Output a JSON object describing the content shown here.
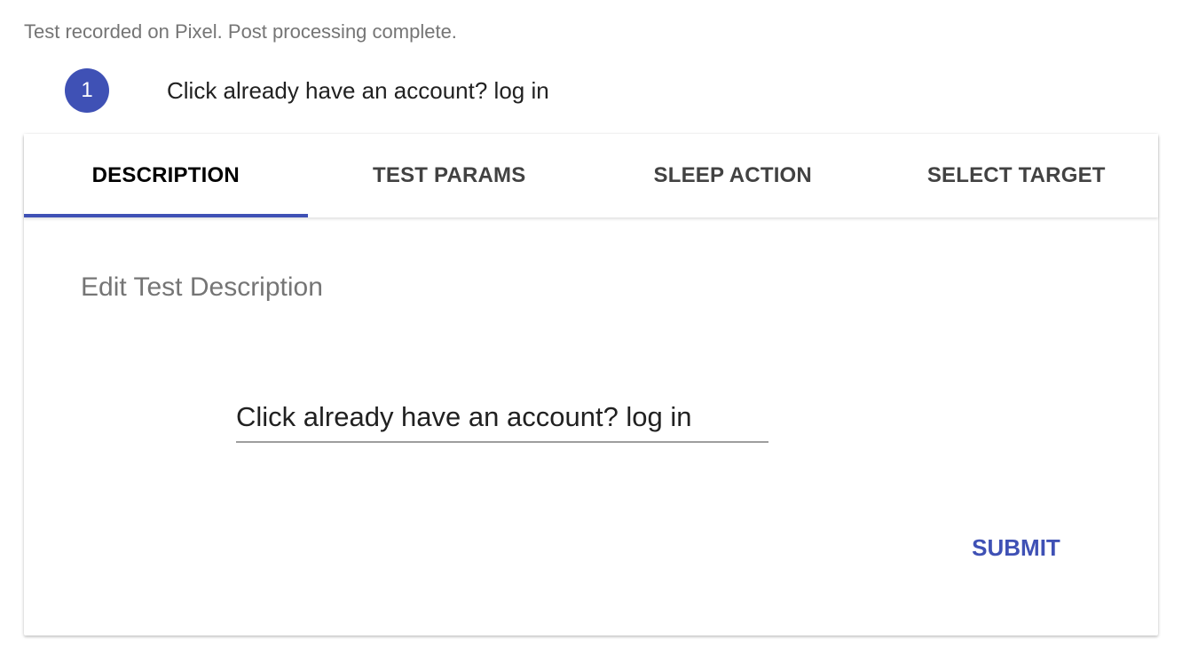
{
  "status": {
    "text": "Test recorded on Pixel. Post processing complete."
  },
  "step": {
    "number": "1",
    "title": "Click already have an account? log in"
  },
  "tabs": [
    {
      "label": "DESCRIPTION",
      "active": true
    },
    {
      "label": "TEST PARAMS",
      "active": false
    },
    {
      "label": "SLEEP ACTION",
      "active": false
    },
    {
      "label": "SELECT TARGET",
      "active": false
    }
  ],
  "description_panel": {
    "title": "Edit Test Description",
    "input_value": "Click already have an account? log in",
    "submit_label": "SUBMIT"
  },
  "colors": {
    "accent": "#3f51b5",
    "muted_text": "#757575",
    "primary_text": "#212121"
  }
}
